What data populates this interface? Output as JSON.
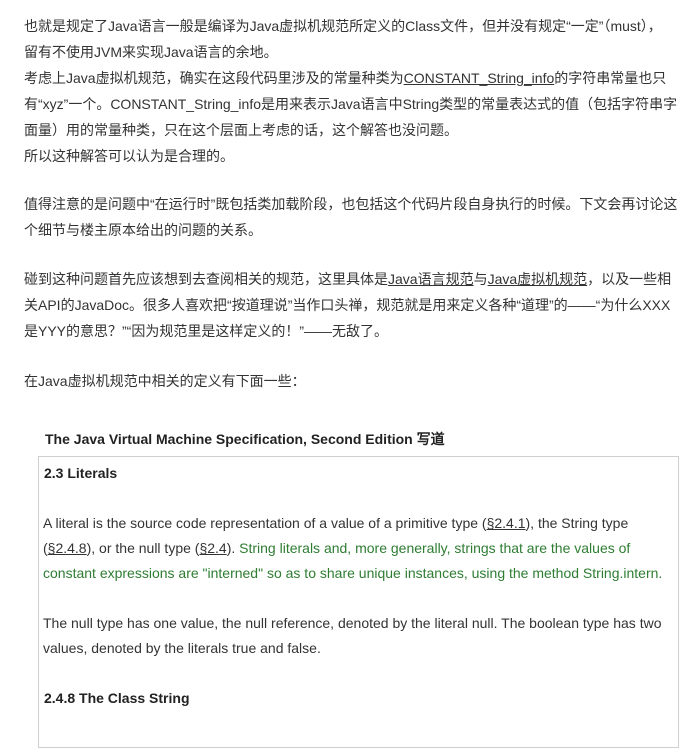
{
  "paragraphs": {
    "p1": {
      "line1": "也就是规定了Java语言一般是编译为Java虚拟机规范所定义的Class文件，但并没有规定“一定”（must），",
      "line2": "留有不使用JVM来实现Java语言的余地。"
    },
    "p2": {
      "prefix": "考虑上Java虚拟机规范，确实在这段代码里涉及的常量种类为",
      "link": "CONSTANT_String_info",
      "suffix1": "的字符串常量也只",
      "line2": "有“xyz”一个。CONSTANT_String_info是用来表示Java语言中String类型的常量表达式的值（包括字符串字",
      "line3": "面量）用的常量种类，只在这个层面上考虑的话，这个解答也没问题。"
    },
    "p3": "所以这种解答可以认为是合理的。",
    "p4": {
      "line1": "值得注意的是问题中“在运行时”既包括类加载阶段，也包括这个代码片段自身执行的时候。下文会再讨论这",
      "line2": "个细节与楼主原本给出的问题的关系。"
    },
    "p5": {
      "prefix": "碰到这种问题首先应该想到去查阅相关的规范，这里具体是",
      "link1": "Java语言规范",
      "mid": "与",
      "link2": "Java虚拟机规范",
      "suffix": "，以及一些相",
      "line2": "关API的JavaDoc。很多人喜欢把“按道理说”当作口头禅，规范就是用来定义各种“道理”的——“为什么XXX",
      "line3": "是YYY的意思？”“因为规范里是这样定义的！”——无敌了。"
    },
    "p6": "在Java虚拟机规范中相关的定义有下面一些："
  },
  "spec": {
    "title": "The Java Virtual Machine Specification, Second Edition 写道",
    "sec1_head": "2.3 Literals",
    "lit": {
      "t1": "A literal is the source code representation of a value of a primitive type (",
      "r1": "§2.4.1",
      "t2": "), the String type",
      "t3": "(",
      "r2": "§2.4.8",
      "t4": "), or the null type (",
      "r3": "§2.4",
      "t5": "). ",
      "green1": "String literals and, more generally, strings that are the values of",
      "green2": "constant expressions are \"interned\" so as to share unique instances, using the method String.intern."
    },
    "null_para": {
      "line1": "The null type has one value, the null reference, denoted by the literal null. The boolean type has two",
      "line2": "values, denoted by the literals true and false."
    },
    "sec2_head": "2.4.8 The Class String"
  },
  "colors": {
    "text": "#333333",
    "green": "#2e7d32",
    "box_border": "#cfcfcf"
  }
}
